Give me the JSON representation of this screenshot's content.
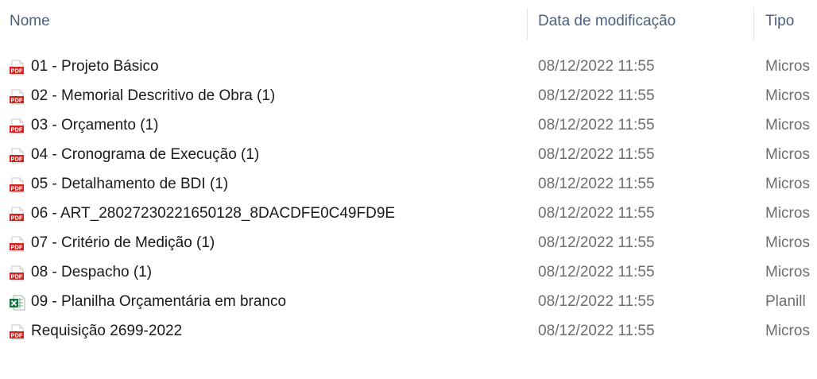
{
  "columns": {
    "name": "Nome",
    "date": "Data de modificação",
    "type": "Tipo"
  },
  "files": [
    {
      "name": "01 - Projeto Básico",
      "date": "08/12/2022 11:55",
      "type": "Micros",
      "icon": "pdf-file-icon"
    },
    {
      "name": "02 - Memorial Descritivo de Obra (1)",
      "date": "08/12/2022 11:55",
      "type": "Micros",
      "icon": "pdf-file-icon"
    },
    {
      "name": "03 - Orçamento (1)",
      "date": "08/12/2022 11:55",
      "type": "Micros",
      "icon": "pdf-file-icon"
    },
    {
      "name": "04 - Cronograma de Execução (1)",
      "date": "08/12/2022 11:55",
      "type": "Micros",
      "icon": "pdf-file-icon"
    },
    {
      "name": "05 - Detalhamento de BDI (1)",
      "date": "08/12/2022 11:55",
      "type": "Micros",
      "icon": "pdf-file-icon"
    },
    {
      "name": "06 - ART_28027230221650128_8DACDFE0C49FD9E",
      "date": "08/12/2022 11:55",
      "type": "Micros",
      "icon": "pdf-file-icon"
    },
    {
      "name": "07 - Critério de Medição (1)",
      "date": "08/12/2022 11:55",
      "type": "Micros",
      "icon": "pdf-file-icon"
    },
    {
      "name": "08 - Despacho (1)",
      "date": "08/12/2022 11:55",
      "type": "Micros",
      "icon": "pdf-file-icon"
    },
    {
      "name": "09 - Planilha Orçamentária em branco",
      "date": "08/12/2022 11:55",
      "type": "Planill",
      "icon": "excel-file-icon"
    },
    {
      "name": "Requisição 2699-2022",
      "date": "08/12/2022 11:55",
      "type": "Micros",
      "icon": "pdf-file-icon"
    }
  ],
  "colors": {
    "header_text": "#4c607a",
    "name_text": "#1a1a1a",
    "meta_text": "#6d6d6d",
    "pdf_icon": "#d4231f",
    "excel_icon": "#1e7145"
  }
}
